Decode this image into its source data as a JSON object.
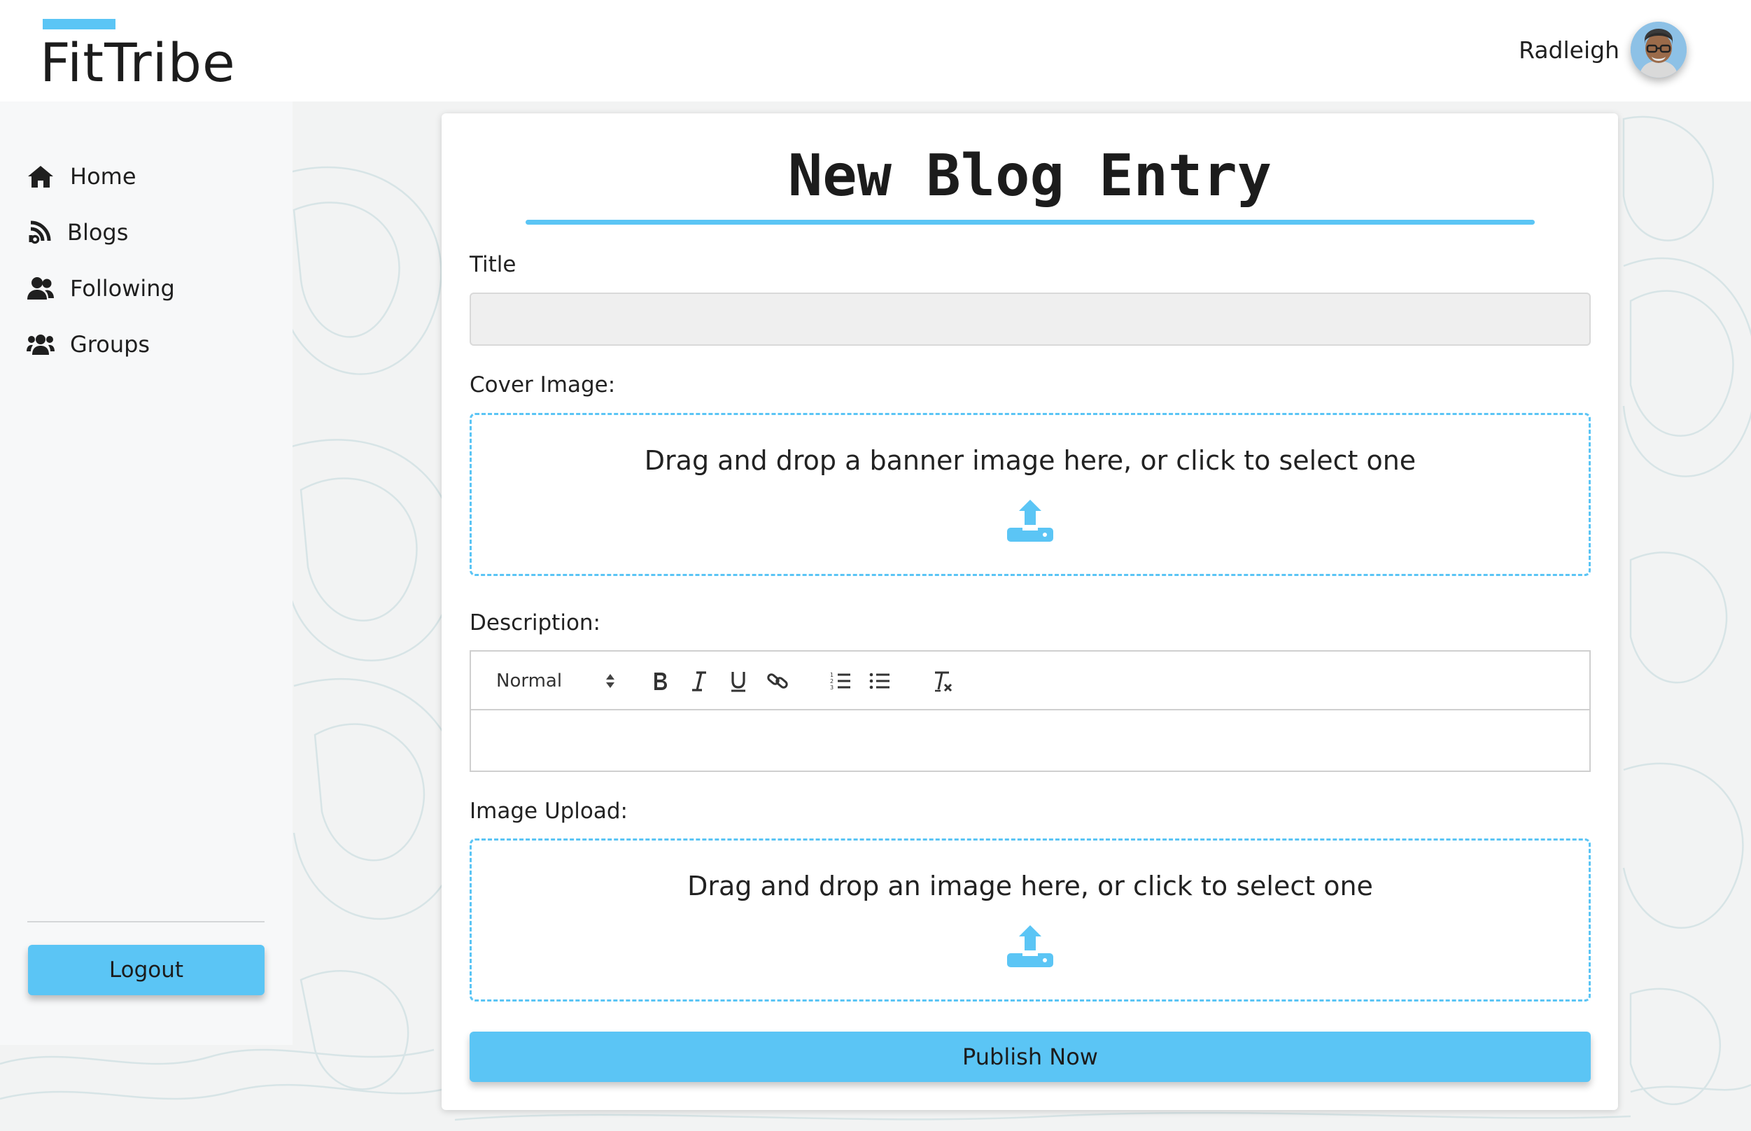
{
  "app": {
    "logo": "FitTribe"
  },
  "user": {
    "name": "Radleigh"
  },
  "sidebar": {
    "items": [
      {
        "label": "Home",
        "icon": "home-icon"
      },
      {
        "label": "Blogs",
        "icon": "rss-icon"
      },
      {
        "label": "Following",
        "icon": "user-group-icon"
      },
      {
        "label": "Groups",
        "icon": "users-icon"
      }
    ],
    "logout_label": "Logout"
  },
  "form": {
    "heading": "New Blog Entry",
    "title_label": "Title",
    "title_value": "",
    "cover_label": "Cover Image:",
    "cover_dropzone_text": "Drag and drop a banner image here, or click to select one",
    "description_label": "Description:",
    "editor": {
      "format_select": "Normal",
      "tools": [
        "bold-icon",
        "italic-icon",
        "underline-icon",
        "link-icon",
        "ordered-list-icon",
        "bullet-list-icon",
        "clear-format-icon"
      ]
    },
    "image_label": "Image Upload:",
    "image_dropzone_text": "Drag and drop an image here, or click to select one",
    "publish_label": "Publish Now"
  },
  "colors": {
    "accent": "#5bc5f5",
    "sidebar_bg": "#f7f8f9",
    "input_bg": "#efefef"
  }
}
